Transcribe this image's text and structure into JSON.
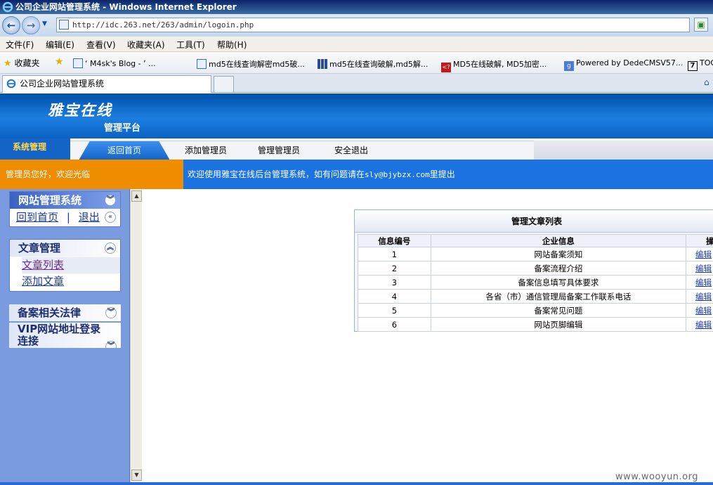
{
  "window": {
    "title": "公司企业网站管理系统 - Windows Internet Explorer"
  },
  "address_bar": {
    "url": "http://idc.263.net/263/admin/logoin.php"
  },
  "menu": [
    "文件(F)",
    "编辑(E)",
    "查看(V)",
    "收藏夹(A)",
    "工具(T)",
    "帮助(H)"
  ],
  "favorites": {
    "label": "收藏夹",
    "items": [
      "‘ M4sk's Blog - ’ ...",
      "md5在线查询解密md5破...",
      "md5在线查询破解,md5解...",
      "MD5在线破解, MD5加密...",
      "Powered by DedeCMSV57...",
      "TOO"
    ]
  },
  "tab": {
    "title": "公司企业网站管理系统"
  },
  "site": {
    "logo": "雅宝在线",
    "subtitle": "管理平台"
  },
  "nav": {
    "section": "系统管理",
    "tabs": [
      "返回首页",
      "添加管理员",
      "管理管理员",
      "安全退出"
    ]
  },
  "notice": {
    "greeting": "管理员您好，欢迎光临",
    "message_prefix": "欢迎使用雅宝在线后台管理系统，如有问题请在",
    "email": "sly@bjybzx.com",
    "message_suffix": "里提出"
  },
  "sidebar": {
    "panel1": {
      "title": "网站管理系统",
      "link_home": "回到首页",
      "separator": "|",
      "link_logout": "退出"
    },
    "panel2": {
      "title": "文章管理",
      "items": [
        "文章列表",
        "添加文章"
      ]
    },
    "panel3": {
      "title": "备案相关法律"
    },
    "panel4": {
      "title": "VIP网站地址登录连接"
    }
  },
  "table": {
    "caption": "管理文章列表",
    "headers": [
      "信息编号",
      "企业信息",
      "操作"
    ],
    "rows": [
      {
        "id": "1",
        "info": "网站备案须知",
        "op": "编辑"
      },
      {
        "id": "2",
        "info": "备案流程介绍",
        "op": "编辑"
      },
      {
        "id": "3",
        "info": "备案信息填写具体要求",
        "op": "编辑"
      },
      {
        "id": "4",
        "info": "各省（市）通信管理局备案工作联系电话",
        "op": "编辑"
      },
      {
        "id": "5",
        "info": "备案常见问题",
        "op": "编辑"
      },
      {
        "id": "6",
        "info": "网站页脚编辑",
        "op": "编辑"
      }
    ]
  },
  "watermark": "www.wooyun.org"
}
